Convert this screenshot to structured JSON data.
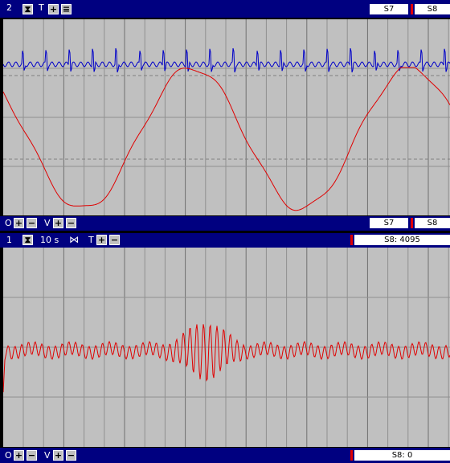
{
  "top_panel": {
    "index": "2",
    "t_label": "T",
    "field_s7": "S7",
    "field_s8": "S8",
    "footer": {
      "o_label": "O",
      "v_label": "V",
      "field_s7": "S7",
      "field_s8": "S8"
    }
  },
  "bottom_panel": {
    "index": "1",
    "time_scale": "10 s",
    "t_label": "T",
    "readout_top": "S8: 4095",
    "footer": {
      "o_label": "O",
      "v_label": "V",
      "readout": "S8: 0"
    }
  },
  "colors": {
    "title_bar": "#000080",
    "plot_bg": "#c0c0c0",
    "grid": "#808080",
    "trace_blue": "#0000c8",
    "trace_red": "#e00000",
    "marker": "#e00000"
  }
}
